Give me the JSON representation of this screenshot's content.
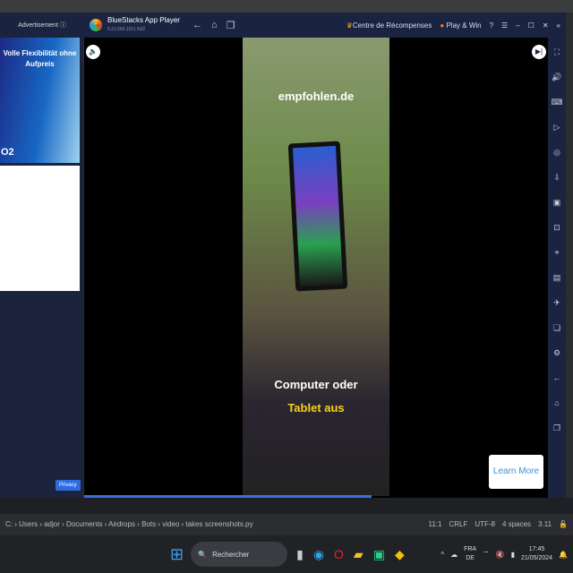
{
  "window": {
    "ad_label": "Advertisement ⓘ",
    "app_name": "BlueStacks App Player",
    "version": "5.21.560.1011 N32",
    "rewards": "Centre de Récompenses",
    "play_win": "Play & Win"
  },
  "ads": {
    "headline": "Volle Flexibilität ohne Aufpreis",
    "brand": "O2",
    "privacy": "Privacy"
  },
  "video": {
    "brand": "empfohlen.de",
    "caption_line1": "Computer oder",
    "caption_line2": "Tablet aus",
    "learn_more": "Learn More",
    "progress_percent": 62
  },
  "statusbar": {
    "breadcrumb": [
      "C:",
      "Users",
      "adjor",
      "Documents",
      "Airdrops",
      "Bots",
      "video",
      "takes screenshots.py"
    ],
    "position": "11:1",
    "eol": "CRLF",
    "encoding": "UTF-8",
    "indent": "4 spaces",
    "interpreter": "3.11"
  },
  "taskbar": {
    "search_placeholder": "Rechercher",
    "lang_top": "FRA",
    "lang_bottom": "DE",
    "time": "17:45",
    "date": "21/05/2024"
  }
}
